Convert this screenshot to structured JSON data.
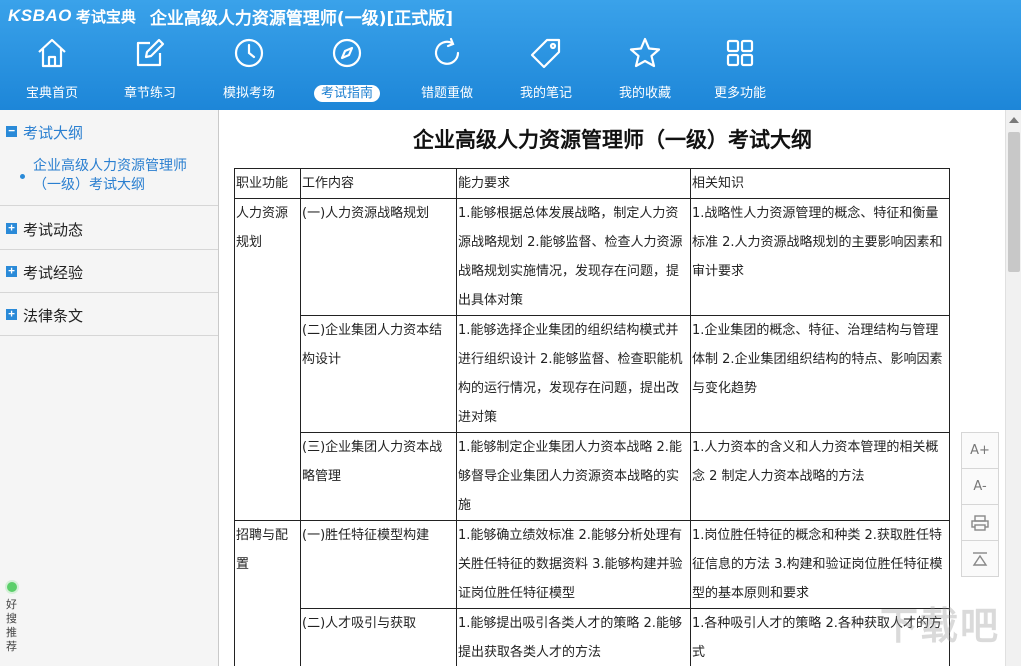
{
  "header": {
    "logo": "KSBAO",
    "logo_cn": "考试宝典",
    "app_title": "企业高级人力资源管理师(一级)[正式版]"
  },
  "nav": [
    {
      "label": "宝典首页",
      "icon": "home-icon"
    },
    {
      "label": "章节练习",
      "icon": "edit-icon"
    },
    {
      "label": "模拟考场",
      "icon": "clock-icon"
    },
    {
      "label": "考试指南",
      "icon": "compass-icon",
      "active": true
    },
    {
      "label": "错题重做",
      "icon": "refresh-icon"
    },
    {
      "label": "我的笔记",
      "icon": "tag-icon"
    },
    {
      "label": "我的收藏",
      "icon": "star-icon"
    },
    {
      "label": "更多功能",
      "icon": "grid-icon"
    }
  ],
  "sidebar": {
    "items": [
      {
        "label": "考试大纲",
        "state": "−"
      },
      {
        "label": "考试动态",
        "state": "+"
      },
      {
        "label": "考试经验",
        "state": "+"
      },
      {
        "label": "法律条文",
        "state": "+"
      }
    ],
    "sub_item": "企业高级人力资源管理师（一级）考试大纲",
    "widget_text": "好搜推荐"
  },
  "doc": {
    "title": "企业高级人力资源管理师（一级）考试大纲",
    "columns": [
      "职业功能",
      "工作内容",
      "能力要求",
      "相关知识"
    ],
    "rows": [
      {
        "func": "人力资源规划",
        "items": [
          {
            "content": "(一)人力资源战略规划",
            "ability": "1.能够根据总体发展战略，制定人力资源战略规划 2.能够监督、检查人力资源战略规划实施情况，发现存在问题，提出具体对策",
            "knowledge": "1.战略性人力资源管理的概念、特征和衡量标准 2.人力资源战略规划的主要影响因素和审计要求"
          },
          {
            "content": "(二)企业集团人力资本结构设计",
            "ability": "1.能够选择企业集团的组织结构模式并进行组织设计 2.能够监督、检查职能机构的运行情况，发现存在问题，提出改进对策",
            "knowledge": "1.企业集团的概念、特征、治理结构与管理体制 2.企业集团组织结构的特点、影响因素与变化趋势"
          },
          {
            "content": "(三)企业集团人力资本战略管理",
            "ability": "1.能够制定企业集团人力资本战略 2.能够督导企业集团人力资源资本战略的实施",
            "knowledge": "1.人力资本的含义和人力资本管理的相关概念 2 制定人力资本战略的方法"
          }
        ]
      },
      {
        "func": "招聘与配置",
        "items": [
          {
            "content": "(一)胜任特征模型构建",
            "ability": "1.能够确立绩效标准 2.能够分析处理有关胜任特征的数据资料 3.能够构建并验证岗位胜任特征模型",
            "knowledge": "1.岗位胜任特征的概念和种类 2.获取胜任特征信息的方法 3.构建和验证岗位胜任特征模型的基本原则和要求"
          },
          {
            "content": "(二)人才吸引与获取",
            "ability": "1.能够提出吸引各类人才的策略 2.能够提出获取各类人才的方法",
            "knowledge": "1.各种吸引人才的策略 2.各种获取人才的方式"
          }
        ]
      }
    ]
  },
  "tools": [
    "A+",
    "A-"
  ],
  "watermark": "下载吧",
  "colors": {
    "header_top": "#3aa2ea",
    "header_bottom": "#1d86d8",
    "accent": "#2a8ad8"
  }
}
